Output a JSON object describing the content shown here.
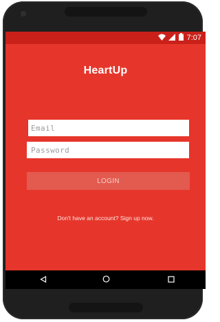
{
  "status_bar": {
    "time": "7:07",
    "icons": [
      "wifi-icon",
      "signal-icon",
      "battery-icon"
    ]
  },
  "app": {
    "title": "HeartUp"
  },
  "login_form": {
    "email_placeholder": "Email",
    "password_placeholder": "Password",
    "login_label": "LOGIN",
    "signup_text": "Don't have an account? Sign up now."
  },
  "nav_bar": {
    "icons": [
      "back-icon",
      "home-icon",
      "recents-icon"
    ]
  },
  "colors": {
    "primary": "#e6362b",
    "status_bar": "#c9211a",
    "button": "#e35a4f"
  }
}
